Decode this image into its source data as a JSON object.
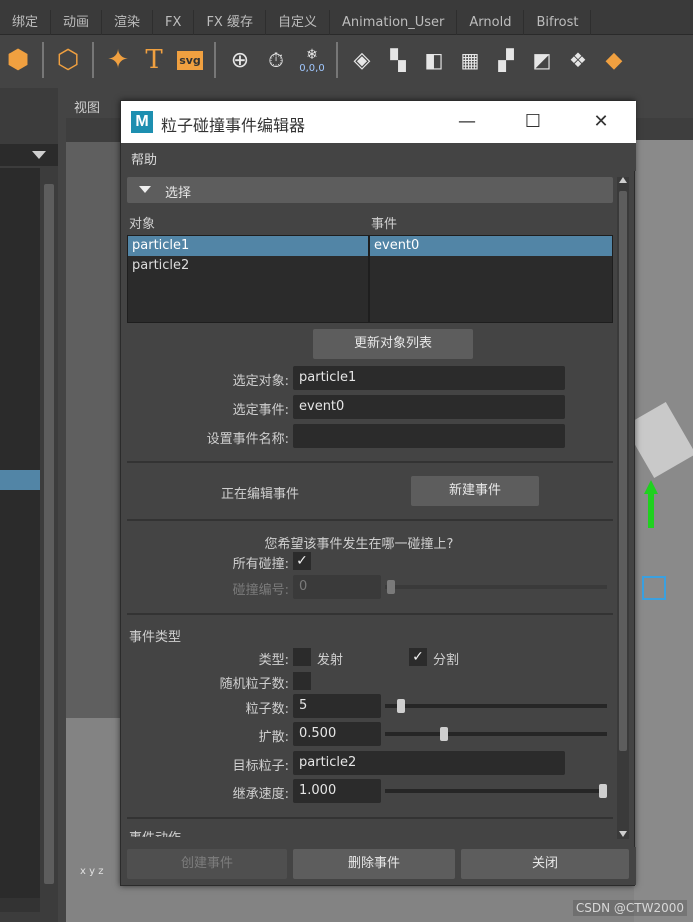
{
  "shelf": {
    "tabs": [
      "绑定",
      "动画",
      "渲染",
      "FX",
      "FX 缓存",
      "自定义",
      "Animation_User",
      "Arnold",
      "Bifrost"
    ],
    "icon_text": {
      "t": "T",
      "svg": "svg",
      "coord": "0,0,0"
    }
  },
  "viewport": {
    "label": "视图",
    "axis": "x y z"
  },
  "watermark": "CSDN @CTW2000",
  "dialog": {
    "app_icon": "M",
    "title": "粒子碰撞事件编辑器",
    "minimize": "—",
    "maximize": "☐",
    "close": "✕",
    "menu": "帮助",
    "section_select": "选择",
    "objects_header": "对象",
    "events_header": "事件",
    "objects": [
      "particle1",
      "particle2"
    ],
    "events": [
      "event0"
    ],
    "update_button": "更新对象列表",
    "selected_object_label": "选定对象:",
    "selected_object_value": "particle1",
    "selected_event_label": "选定事件:",
    "selected_event_value": "event0",
    "set_event_name_label": "设置事件名称:",
    "set_event_name_value": "",
    "editing_event_label": "正在编辑事件",
    "new_event_button": "新建事件",
    "question": "您希望该事件发生在哪一碰撞上?",
    "all_collisions_label": "所有碰撞:",
    "all_collisions_checked": "✓",
    "collision_number_label": "碰撞编号:",
    "collision_number_value": "0",
    "event_type_header": "事件类型",
    "type_label": "类型:",
    "emit_label": "发射",
    "split_label": "分割",
    "split_checked": "✓",
    "random_particles_label": "随机粒子数:",
    "particle_count_label": "粒子数:",
    "particle_count_value": "5",
    "spread_label": "扩散:",
    "spread_value": "0.500",
    "target_particle_label": "目标粒子:",
    "target_particle_value": "particle2",
    "inherit_velocity_label": "继承速度:",
    "inherit_velocity_value": "1.000",
    "event_actions_header": "事件动作",
    "create_event_button": "创建事件",
    "delete_event_button": "删除事件",
    "close_button": "关闭"
  },
  "colors": {
    "accent": "#5285a6",
    "field": "#2b2b2b",
    "panel": "#444444",
    "button": "#5d5d5d"
  }
}
